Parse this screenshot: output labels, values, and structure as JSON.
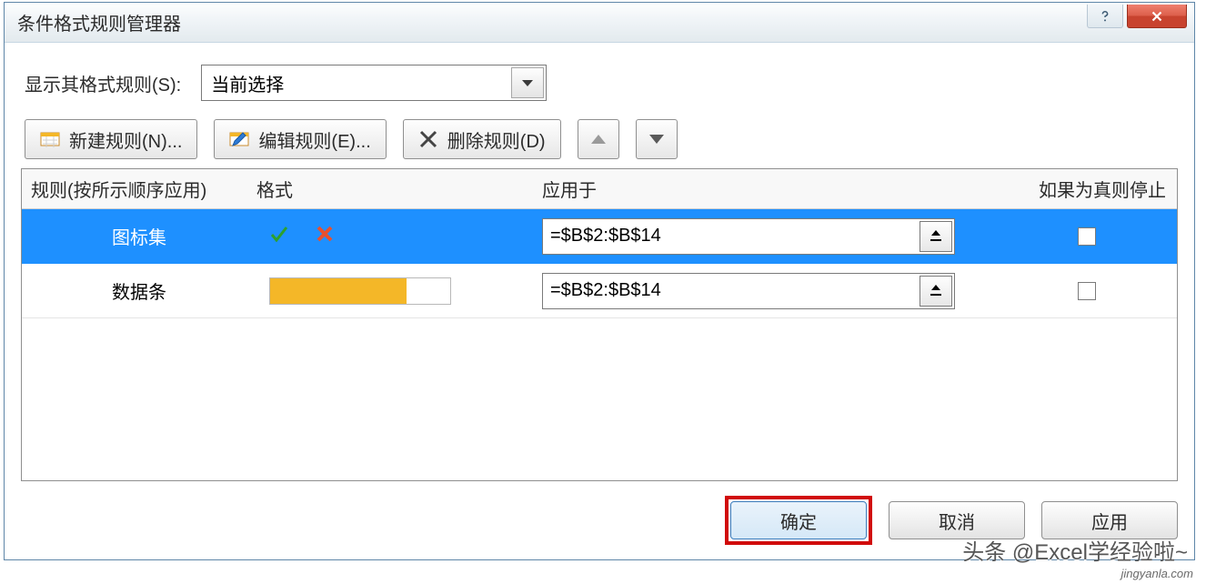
{
  "dialog": {
    "title": "条件格式规则管理器",
    "help_icon": "help-icon",
    "close_icon": "close-icon"
  },
  "scope": {
    "label": "显示其格式规则(S):",
    "selected": "当前选择"
  },
  "toolbar": {
    "new_rule": "新建规则(N)...",
    "edit_rule": "编辑规则(E)...",
    "delete_rule": "删除规则(D)"
  },
  "columns": {
    "rule": "规则(按所示顺序应用)",
    "format": "格式",
    "applies_to": "应用于",
    "stop_if_true": "如果为真则停止"
  },
  "rules": [
    {
      "name": "图标集",
      "type": "iconset",
      "range": "=$B$2:$B$14",
      "stop": false,
      "selected": true
    },
    {
      "name": "数据条",
      "type": "databar",
      "range": "=$B$2:$B$14",
      "stop": false,
      "selected": false
    }
  ],
  "footer": {
    "ok": "确定",
    "cancel": "取消",
    "apply": "应用"
  },
  "watermark": {
    "main": "头条 @Excel学经验啦~",
    "sub": "jingyanla.com"
  }
}
